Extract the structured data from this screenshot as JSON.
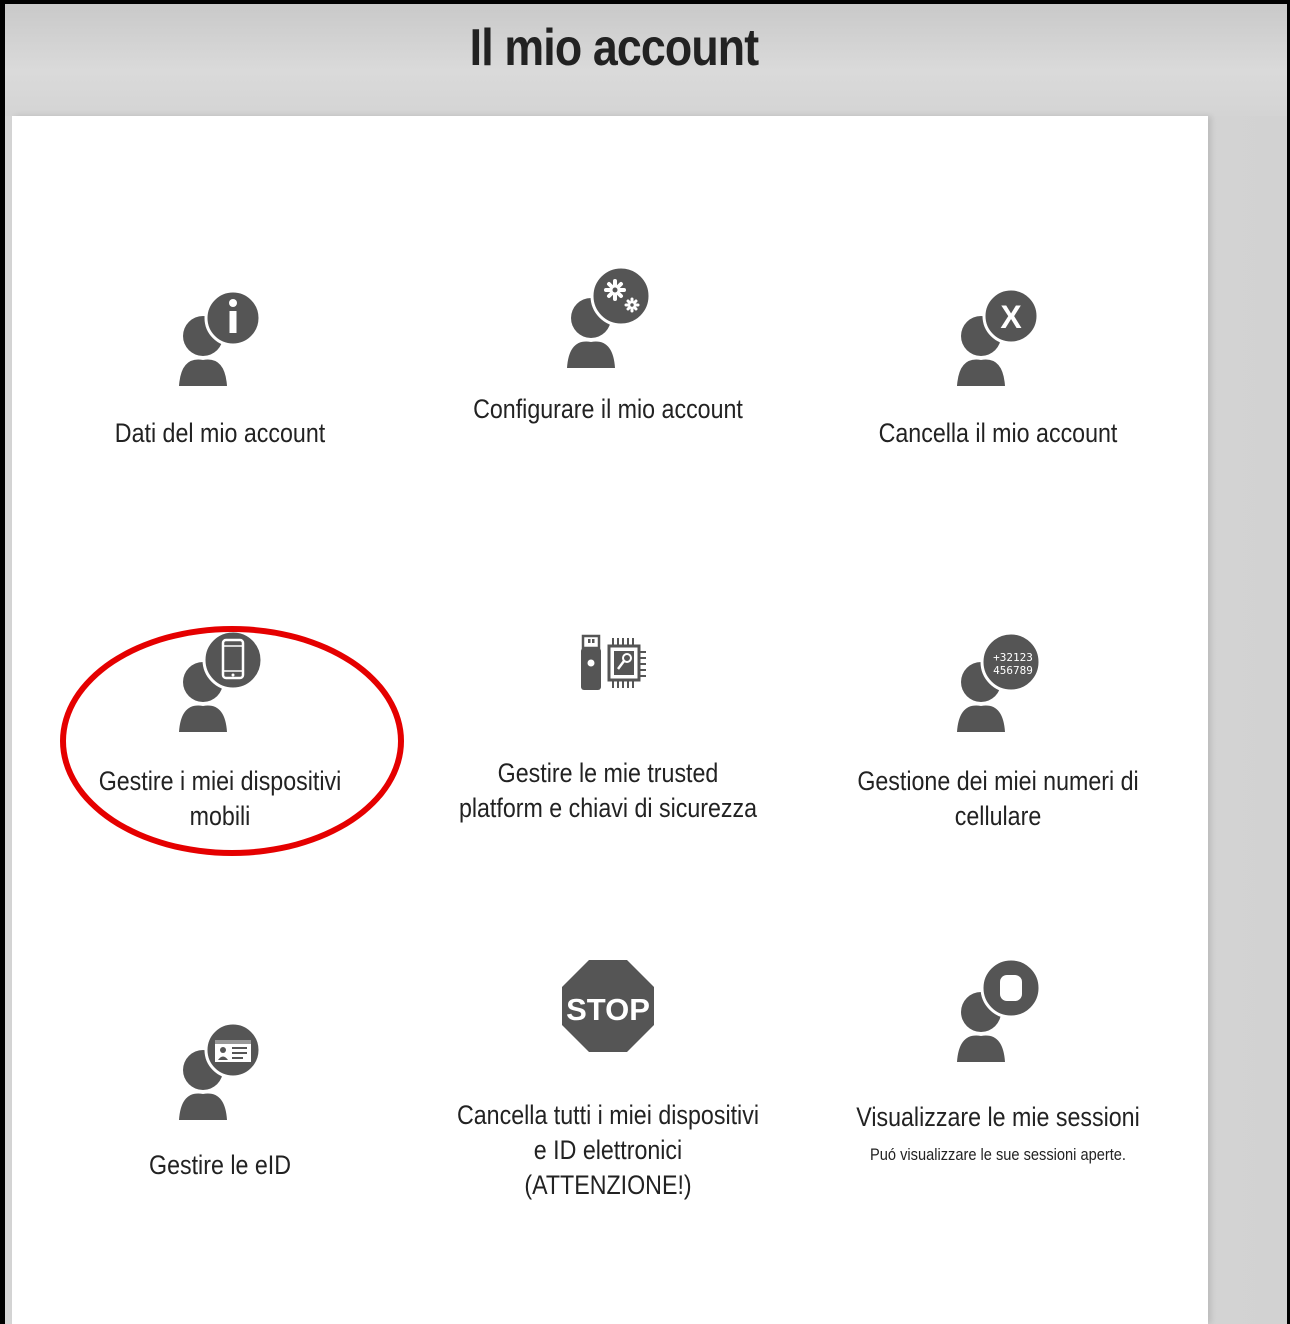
{
  "page": {
    "title": "Il mio account"
  },
  "tiles": [
    {
      "label": "Dati del mio account",
      "icon": "person-info-icon"
    },
    {
      "label": "Configurare il mio account",
      "icon": "person-gears-icon"
    },
    {
      "label": "Cancella il mio account",
      "icon": "person-delete-icon"
    },
    {
      "label": "Gestire i miei dispositivi mobili",
      "icon": "person-smartphone-icon"
    },
    {
      "label": "Gestire le mie trusted platform e chiavi di sicurezza",
      "icon": "usb-key-chip-icon"
    },
    {
      "label": "Gestione dei miei numeri di cellulare",
      "icon": "person-phone-number-icon",
      "badge_line1": "+32123",
      "badge_line2": "456789"
    },
    {
      "label": "Gestire le eID",
      "icon": "person-id-card-icon"
    },
    {
      "label": "Cancella tutti i miei dispositivi e ID elettronici (ATTENZIONE!)",
      "icon": "stop-sign-icon",
      "sign_text": "STOP"
    },
    {
      "label": "Visualizzare le mie sessioni",
      "icon": "person-sessions-icon",
      "description": "Puó visualizzare le sue sessioni aperte."
    }
  ],
  "colors": {
    "icon": "#555555",
    "annotation": "#e50000",
    "text": "#222222"
  }
}
